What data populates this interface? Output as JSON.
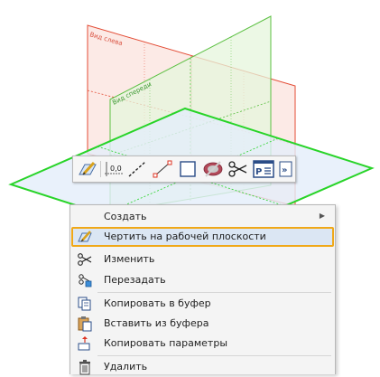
{
  "viewport": {
    "plane_labels": {
      "left_view": "Вид слева",
      "front_view": "Вид спереди"
    },
    "colors": {
      "red_plane": "#e34b34",
      "green_plane": "#5cc043",
      "horizontal_plane": "#28d428",
      "highlight_border": "#f0a818"
    }
  },
  "toolbar": {
    "buttons": [
      {
        "name": "sketch-on-plane",
        "icon": "pencil-sheet-icon"
      },
      {
        "name": "dimension",
        "icon": "dimension-icon",
        "text": "0,0"
      },
      {
        "name": "dash-line",
        "icon": "dash-line-icon"
      },
      {
        "name": "line",
        "icon": "line-icon"
      },
      {
        "name": "rectangle",
        "icon": "rectangle-icon"
      },
      {
        "name": "hide",
        "icon": "hide-eye-icon"
      },
      {
        "name": "cut",
        "icon": "scissors-icon"
      },
      {
        "name": "parameters",
        "icon": "parameters-icon",
        "text": "P"
      },
      {
        "name": "more",
        "icon": "double-chevron-right-icon",
        "text": "»"
      }
    ]
  },
  "context_menu": {
    "items": [
      {
        "label": "Создать",
        "icon": "",
        "has_submenu": true
      },
      {
        "label": "Чертить на рабочей плоскости",
        "icon": "pencil-sheet-icon",
        "highlighted": true
      },
      {
        "label": "Изменить",
        "icon": "scissors-edit-icon"
      },
      {
        "label": "Перезадать",
        "icon": "redefine-icon"
      },
      {
        "label": "Копировать в буфер",
        "icon": "copy-icon"
      },
      {
        "label": "Вставить из буфера",
        "icon": "paste-icon"
      },
      {
        "label": "Копировать параметры",
        "icon": "copy-params-icon"
      },
      {
        "label": "Удалить",
        "icon": "trash-icon"
      }
    ]
  }
}
